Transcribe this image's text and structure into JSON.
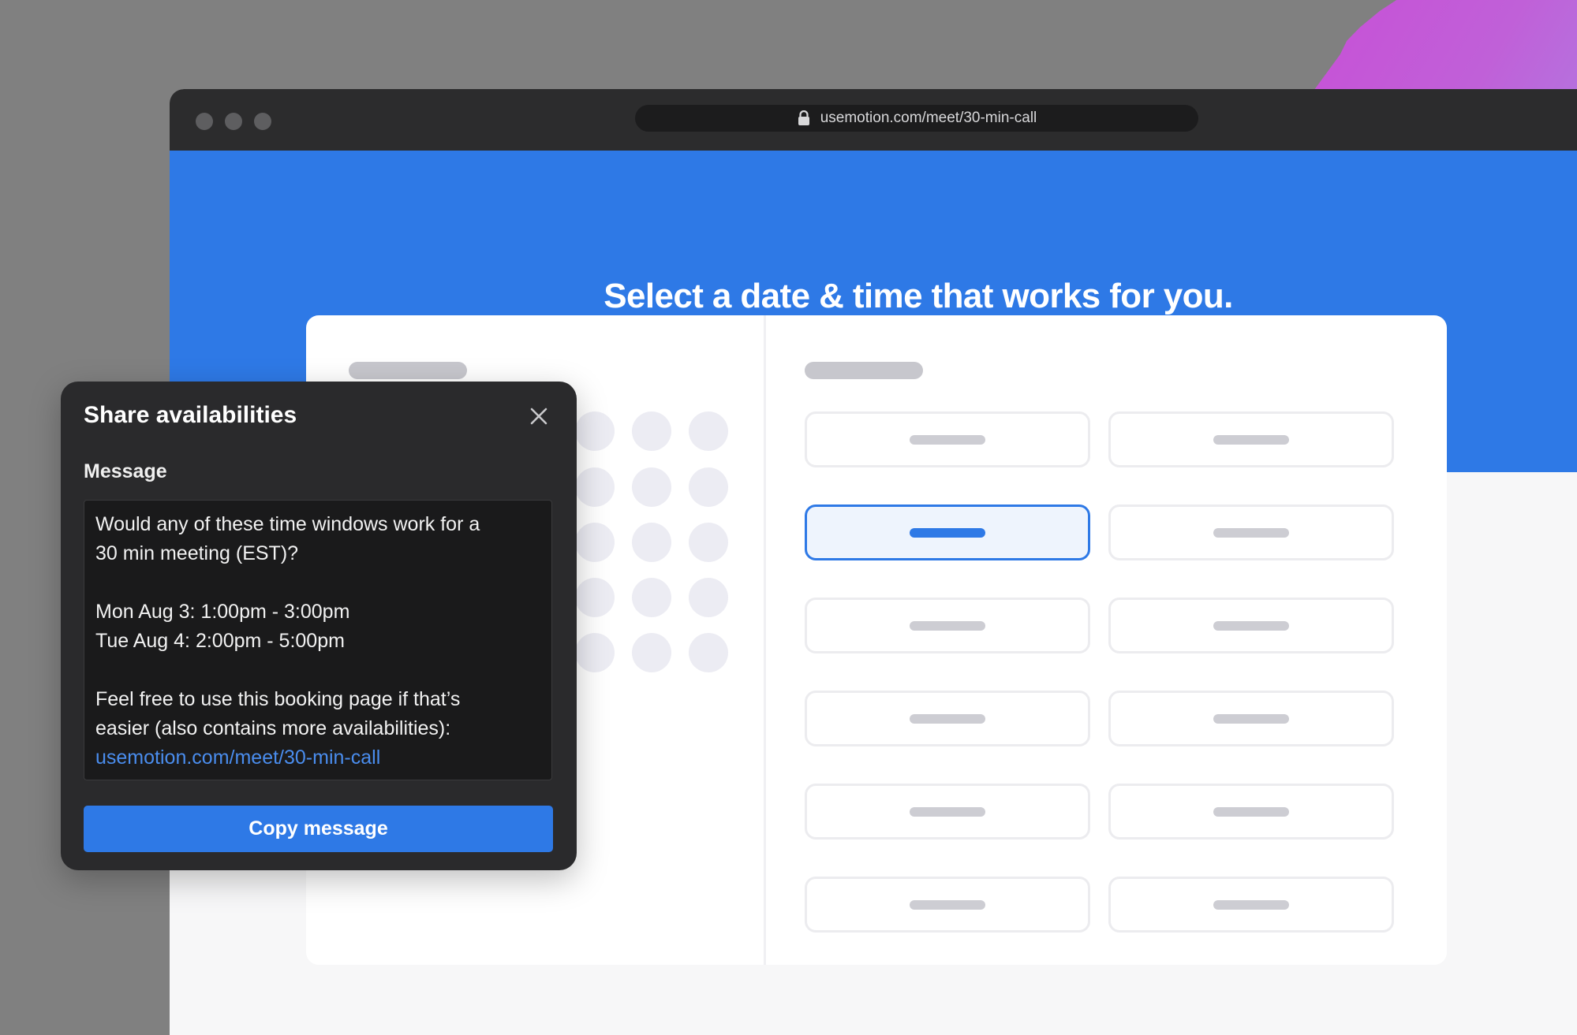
{
  "browser": {
    "url": "usemotion.com/meet/30-min-call",
    "window_controls": [
      "close-dot",
      "minimize-dot",
      "maximize-dot"
    ]
  },
  "page": {
    "heading": "Select a date & time that works for you.",
    "brand_color": "#2e79e6",
    "selected_time_slot": {
      "row": 2,
      "column": 1
    }
  },
  "dialog": {
    "title": "Share availabilities",
    "message_label": "Message",
    "message_lines": {
      "line1": "Would any of these time windows work for a",
      "line2": "30 min meeting (EST)?",
      "line3": "Mon Aug 3: 1:00pm - 3:00pm",
      "line4": "Tue Aug 4: 2:00pm - 5:00pm",
      "line5": "Feel free to use this booking page if that’s",
      "line6": "easier (also contains more availabilities):",
      "link": "usemotion.com/meet/30-min-call"
    },
    "copy_button": "Copy message",
    "close_icon": "close-icon"
  },
  "icons": {
    "lock": "lock-icon",
    "close": "close-icon"
  }
}
